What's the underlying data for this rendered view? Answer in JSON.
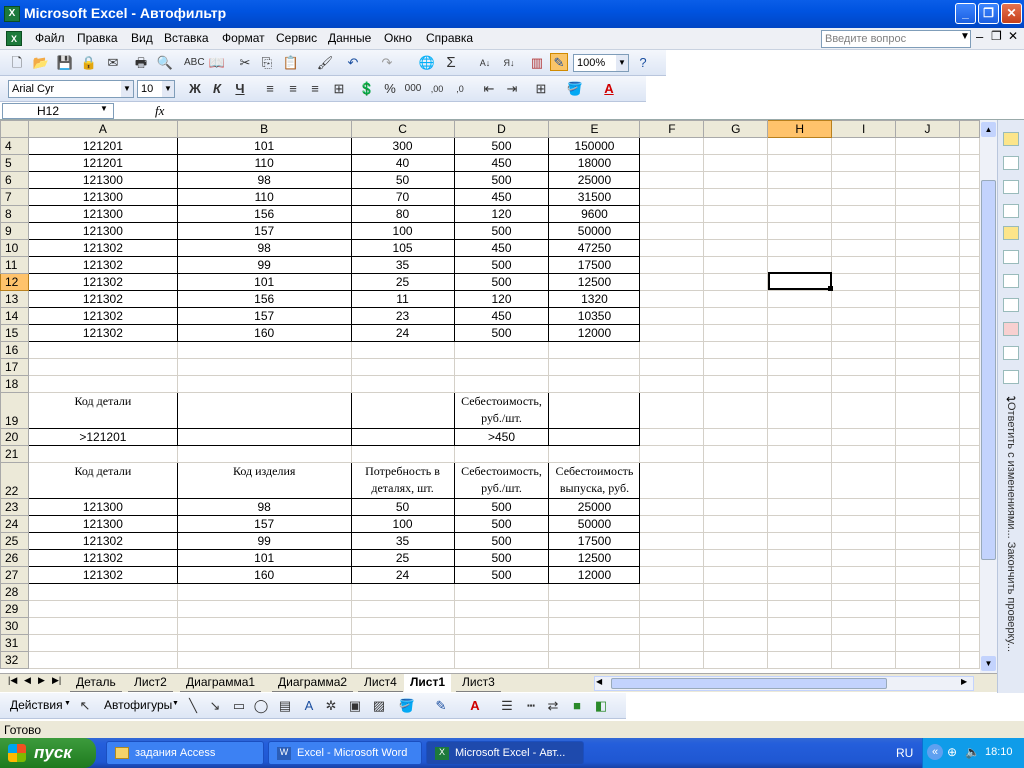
{
  "window": {
    "title": "Microsoft Excel - Автофильтр"
  },
  "menu": {
    "items": [
      "Файл",
      "Правка",
      "Вид",
      "Вставка",
      "Формат",
      "Сервис",
      "Данные",
      "Окно",
      "Справка"
    ],
    "ask_placeholder": "Введите вопрос"
  },
  "toolbar": {
    "zoom": "100%",
    "font": "Arial Cyr",
    "size": "10"
  },
  "formula": {
    "cell": "H12",
    "fx": "fx",
    "value": ""
  },
  "columns": [
    "",
    "A",
    "B",
    "C",
    "D",
    "E",
    "F",
    "G",
    "H",
    "I",
    "J"
  ],
  "rows": [
    {
      "n": "4",
      "a": "121201",
      "b": "101",
      "c": "300",
      "d": "500",
      "e": "150000"
    },
    {
      "n": "5",
      "a": "121201",
      "b": "110",
      "c": "40",
      "d": "450",
      "e": "18000"
    },
    {
      "n": "6",
      "a": "121300",
      "b": "98",
      "c": "50",
      "d": "500",
      "e": "25000"
    },
    {
      "n": "7",
      "a": "121300",
      "b": "110",
      "c": "70",
      "d": "450",
      "e": "31500"
    },
    {
      "n": "8",
      "a": "121300",
      "b": "156",
      "c": "80",
      "d": "120",
      "e": "9600"
    },
    {
      "n": "9",
      "a": "121300",
      "b": "157",
      "c": "100",
      "d": "500",
      "e": "50000"
    },
    {
      "n": "10",
      "a": "121302",
      "b": "98",
      "c": "105",
      "d": "450",
      "e": "47250"
    },
    {
      "n": "11",
      "a": "121302",
      "b": "99",
      "c": "35",
      "d": "500",
      "e": "17500"
    },
    {
      "n": "12",
      "a": "121302",
      "b": "101",
      "c": "25",
      "d": "500",
      "e": "12500"
    },
    {
      "n": "13",
      "a": "121302",
      "b": "156",
      "c": "11",
      "d": "120",
      "e": "1320"
    },
    {
      "n": "14",
      "a": "121302",
      "b": "157",
      "c": "23",
      "d": "450",
      "e": "10350"
    },
    {
      "n": "15",
      "a": "121302",
      "b": "160",
      "c": "24",
      "d": "500",
      "e": "12000"
    }
  ],
  "criteria": {
    "header_a": "Код детали",
    "header_d": "Себестоимость, руб./шт.",
    "value_a": ">121201",
    "value_d": ">450"
  },
  "result_headers": {
    "a": "Код детали",
    "b": "Код изделия",
    "c": "Потребность в деталях, шт.",
    "d": "Себестоимость, руб./шт.",
    "e": "Себестоимость выпуска, руб."
  },
  "results": [
    {
      "n": "23",
      "a": "121300",
      "b": "98",
      "c": "50",
      "d": "500",
      "e": "25000"
    },
    {
      "n": "24",
      "a": "121300",
      "b": "157",
      "c": "100",
      "d": "500",
      "e": "50000"
    },
    {
      "n": "25",
      "a": "121302",
      "b": "99",
      "c": "35",
      "d": "500",
      "e": "17500"
    },
    {
      "n": "26",
      "a": "121302",
      "b": "101",
      "c": "25",
      "d": "500",
      "e": "12500"
    },
    {
      "n": "27",
      "a": "121302",
      "b": "160",
      "c": "24",
      "d": "500",
      "e": "12000"
    }
  ],
  "row_labels": {
    "r16": "16",
    "r17": "17",
    "r18": "18",
    "r19": "19",
    "r20": "20",
    "r21": "21",
    "r22": "22",
    "r28": "28",
    "r29": "29",
    "r30": "30",
    "r31": "31",
    "r32": "32"
  },
  "sheet_tabs": [
    "Деталь",
    "Лист2",
    "Диаграмма1",
    "Диаграмма2",
    "Лист4",
    "Лист1",
    "Лист3"
  ],
  "active_tab": "Лист1",
  "draw": {
    "actions": "Действия",
    "autoshapes": "Автофигуры"
  },
  "taskpane_text": "Ответить с изменениями... Закончить проверку...",
  "status": "Готово",
  "taskbar": {
    "start": "пуск",
    "tasks": [
      "задания Access",
      "Excel - Microsoft Word",
      "Microsoft Excel - Авт..."
    ],
    "lang": "RU",
    "time": "18:10"
  }
}
